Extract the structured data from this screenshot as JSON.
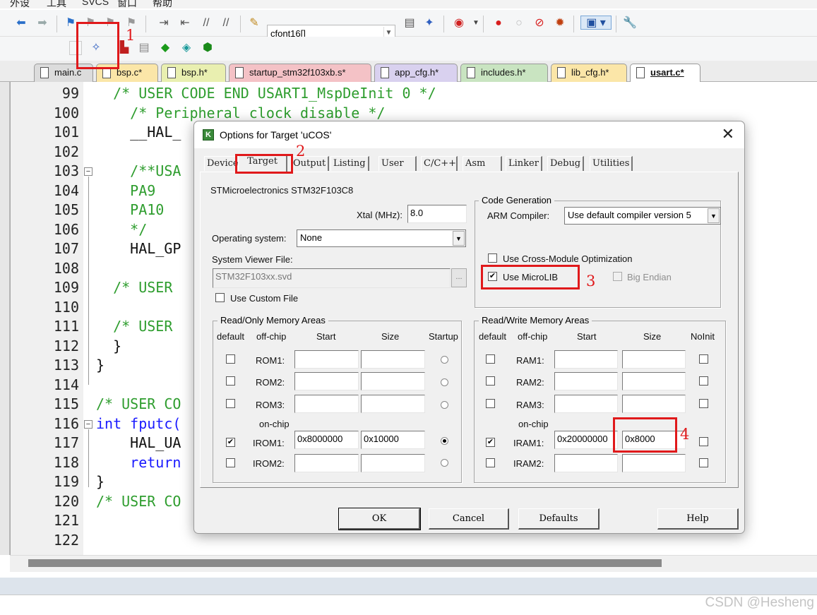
{
  "menubar": {
    "items": [
      "外设",
      "工具",
      "SVCS",
      "窗口",
      "帮助"
    ]
  },
  "toolbar": {
    "target_combo": "cfont16[]"
  },
  "file_tabs": [
    "main.c",
    "bsp.c*",
    "bsp.h*",
    "startup_stm32f103xb.s*",
    "app_cfg.h*",
    "includes.h*",
    "lib_cfg.h*",
    "usart.c*"
  ],
  "editor": {
    "line_numbers": [
      "99",
      "100",
      "101",
      "102",
      "103",
      "104",
      "105",
      "106",
      "107",
      "108",
      "109",
      "110",
      "111",
      "112",
      "113",
      "114",
      "115",
      "116",
      "117",
      "118",
      "119",
      "120",
      "121",
      "122"
    ],
    "lines": [
      "  /* USER CODE END USART1_MspDeInit 0 */",
      "    /* Peripheral clock disable */",
      "    __HAL_",
      "",
      "    /**USA",
      "    PA9",
      "    PA10",
      "    */",
      "    HAL_GP",
      "",
      "  /* USER",
      "",
      "  /* USER",
      "  }",
      "}",
      "",
      "/* USER CO",
      "int fputc(",
      "    HAL_UA",
      "    return",
      "}",
      "/* USER CO",
      "",
      ""
    ]
  },
  "dialog": {
    "title": "Options for Target 'uCOS'",
    "close_glyph": "✕",
    "tabs": [
      "Device",
      "Target",
      "Output",
      "Listing",
      "User",
      "C/C++",
      "Asm",
      "Linker",
      "Debug",
      "Utilities"
    ],
    "active_tab": "Target",
    "device_name": "STMicroelectronics STM32F103C8",
    "xtal_label": "Xtal (MHz):",
    "xtal_value": "8.0",
    "os_label": "Operating system:",
    "os_value": "None",
    "svf_label": "System Viewer File:",
    "svf_value": "STM32F103xx.svd",
    "browse_label": "...",
    "custom_file_label": "Use Custom File",
    "code_gen": {
      "title": "Code Generation",
      "compiler_label": "ARM Compiler:",
      "compiler_value": "Use default compiler version 5",
      "cross_module_label": "Use Cross-Module Optimization",
      "microlib_label": "Use MicroLIB",
      "microlib_checked": true,
      "big_endian_label": "Big Endian"
    },
    "ro_memory": {
      "title": "Read/Only Memory Areas",
      "headers": [
        "default",
        "off-chip",
        "Start",
        "Size",
        "Startup"
      ],
      "onchip_label": "on-chip",
      "rows": [
        {
          "name": "ROM1:",
          "start": "",
          "size": "",
          "default": false,
          "startup": false
        },
        {
          "name": "ROM2:",
          "start": "",
          "size": "",
          "default": false,
          "startup": false
        },
        {
          "name": "ROM3:",
          "start": "",
          "size": "",
          "default": false,
          "startup": false
        },
        {
          "name": "IROM1:",
          "start": "0x8000000",
          "size": "0x10000",
          "default": true,
          "startup": true
        },
        {
          "name": "IROM2:",
          "start": "",
          "size": "",
          "default": false,
          "startup": false
        }
      ]
    },
    "rw_memory": {
      "title": "Read/Write Memory Areas",
      "headers": [
        "default",
        "off-chip",
        "Start",
        "Size",
        "NoInit"
      ],
      "onchip_label": "on-chip",
      "rows": [
        {
          "name": "RAM1:",
          "start": "",
          "size": "",
          "default": false
        },
        {
          "name": "RAM2:",
          "start": "",
          "size": "",
          "default": false
        },
        {
          "name": "RAM3:",
          "start": "",
          "size": "",
          "default": false
        },
        {
          "name": "IRAM1:",
          "start": "0x20000000",
          "size": "0x8000",
          "default": true
        },
        {
          "name": "IRAM2:",
          "start": "",
          "size": "",
          "default": false
        }
      ]
    },
    "buttons": {
      "ok": "OK",
      "cancel": "Cancel",
      "defaults": "Defaults",
      "help": "Help"
    }
  },
  "annotations": [
    "1",
    "2",
    "3",
    "4"
  ],
  "watermark": "CSDN @Hesheng",
  "colors": {
    "annotation": "#e0191b",
    "comment": "#2e9d2e",
    "keyword": "#1a1aff"
  }
}
